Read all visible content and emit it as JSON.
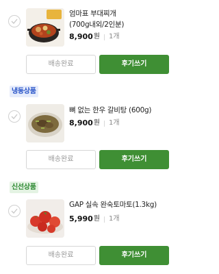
{
  "orders": [
    {
      "name_line1": "엄마표 부대찌개",
      "name_line2": "(700g내외/2인분)",
      "price": "8,900",
      "currency": "원",
      "quantity": "1개",
      "ship_label": "배송완료",
      "review_label": "후기쓰기"
    },
    {
      "section": "냉동상품",
      "name_line1": "뼈 없는 한우 갈비탕 (600g)",
      "price": "8,900",
      "currency": "원",
      "quantity": "1개",
      "ship_label": "배송완료",
      "review_label": "후기쓰기"
    },
    {
      "section": "신선상품",
      "name_line1": "GAP 실속 완숙토마토(1.3kg)",
      "price": "5,990",
      "currency": "원",
      "quantity": "1개",
      "ship_label": "배송완료",
      "review_label": "후기쓰기"
    }
  ],
  "colors": {
    "review_button": "#3f8f34",
    "frozen_badge": "#2b56c9",
    "fresh_badge": "#2f8a34"
  },
  "icons": {
    "checkbox": "check-icon"
  }
}
